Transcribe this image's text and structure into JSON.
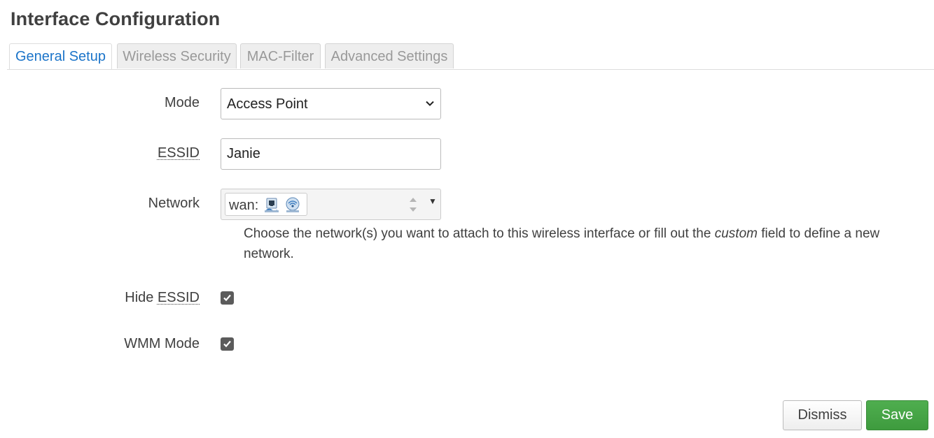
{
  "page": {
    "title": "Interface Configuration"
  },
  "tabs": [
    {
      "label": "General Setup",
      "active": true
    },
    {
      "label": "Wireless Security",
      "active": false
    },
    {
      "label": "MAC-Filter",
      "active": false
    },
    {
      "label": "Advanced Settings",
      "active": false
    }
  ],
  "form": {
    "mode": {
      "label": "Mode",
      "value": "Access Point"
    },
    "essid": {
      "label": "ESSID",
      "value": "Janie"
    },
    "network": {
      "label": "Network",
      "chip_label": "wan:",
      "chip_icons": [
        "ethernet-port-icon",
        "wireless-network-icon"
      ],
      "help_before": "Choose the network(s) you want to attach to this wireless interface or fill out the ",
      "help_emphasis": "custom",
      "help_after": " field to define a new network."
    },
    "hide_essid": {
      "label_prefix": "Hide ",
      "label_abbr": "ESSID",
      "checked": true
    },
    "wmm_mode": {
      "label": "WMM Mode",
      "checked": true
    }
  },
  "actions": {
    "dismiss_label": "Dismiss",
    "save_label": "Save"
  },
  "colors": {
    "active_tab": "#1b74c9",
    "save_button": "#45a345",
    "checkbox": "#5b5b5b"
  }
}
